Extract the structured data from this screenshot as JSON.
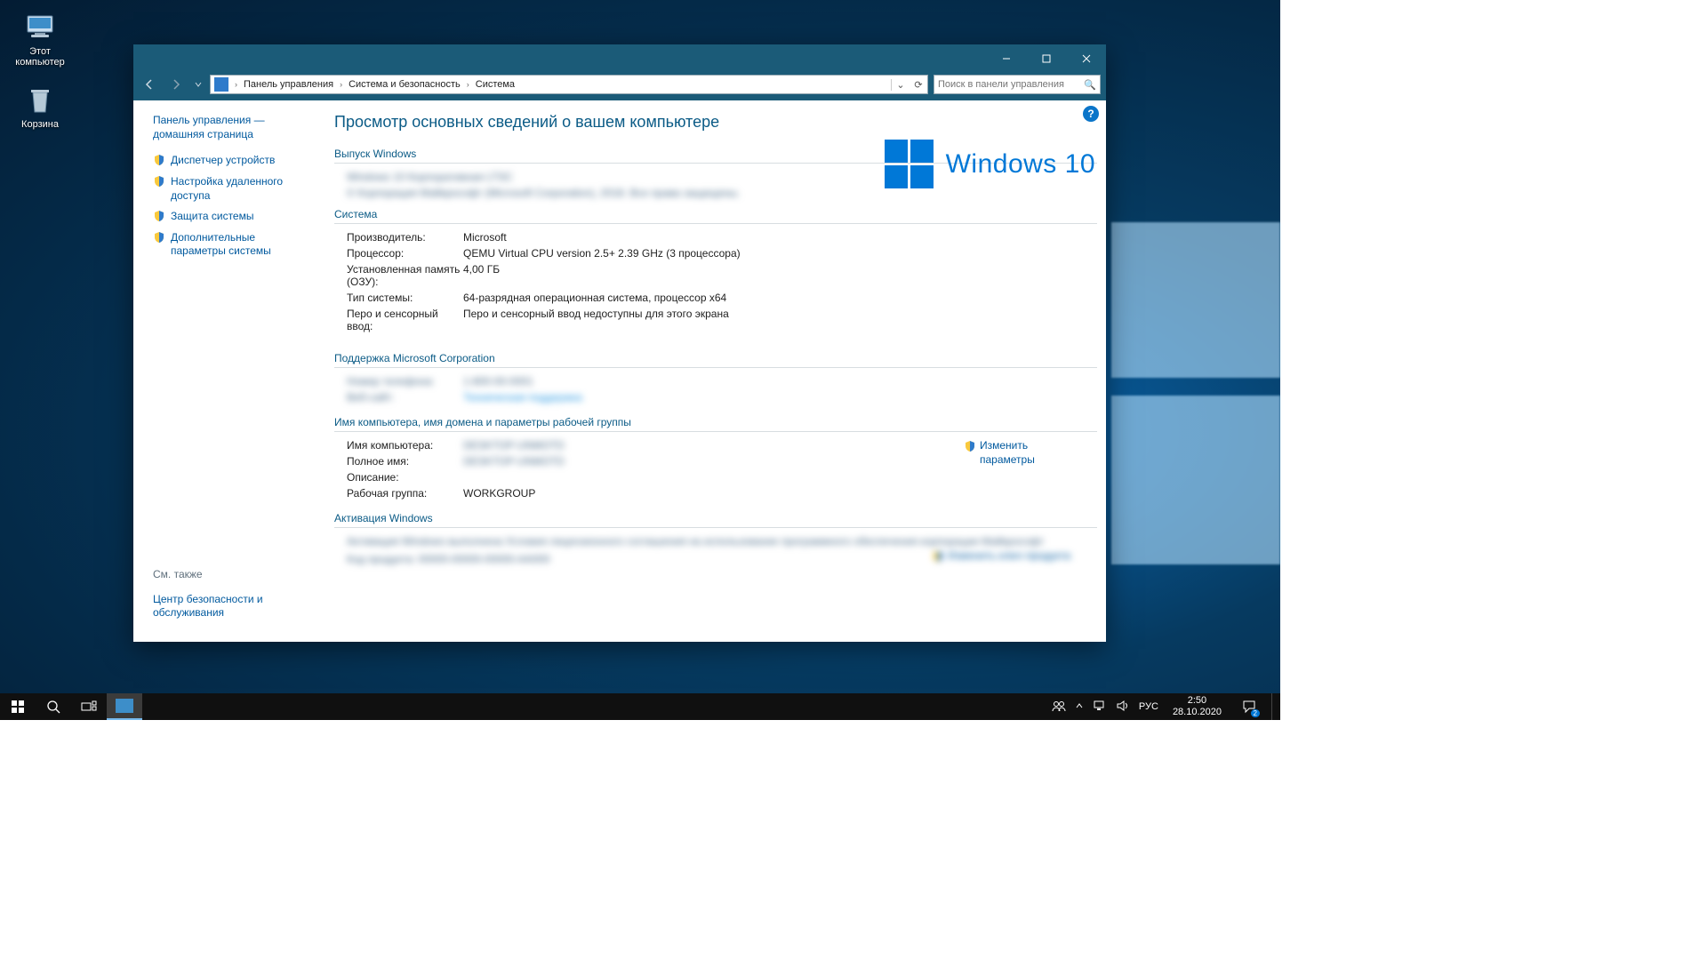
{
  "desktop": {
    "icons": {
      "pc": "Этот компьютер",
      "bin": "Корзина"
    }
  },
  "titlebar": {
    "min": "—",
    "max": "▢",
    "close": "✕"
  },
  "nav": {
    "crumbs": [
      "Панель управления",
      "Система и безопасность",
      "Система"
    ],
    "search_placeholder": "Поиск в панели управления"
  },
  "sidebar": {
    "home": "Панель управления — домашняя страница",
    "tasks": [
      "Диспетчер устройств",
      "Настройка удаленного доступа",
      "Защита системы",
      "Дополнительные параметры системы"
    ],
    "see_also_hd": "См. также",
    "see_also": [
      "Центр безопасности и обслуживания"
    ]
  },
  "main": {
    "title": "Просмотр основных сведений о вашем компьютере",
    "edition_hd": "Выпуск Windows",
    "edition_line1": "Windows 10 Корпоративная LTSC",
    "edition_line2": "© Корпорация Майкрософт (Microsoft Corporation), 2018. Все права защищены.",
    "logo_text": "Windows 10",
    "system_hd": "Система",
    "system": {
      "manufacturer_k": "Производитель:",
      "manufacturer_v": "Microsoft",
      "processor_k": "Процессор:",
      "processor_v": "QEMU Virtual CPU version 2.5+   2.39 GHz  (3 процессора)",
      "ram_k": "Установленная память (ОЗУ):",
      "ram_v": "4,00 ГБ",
      "type_k": "Тип системы:",
      "type_v": "64-разрядная операционная система, процессор x64",
      "pen_k": "Перо и сенсорный ввод:",
      "pen_v": "Перо и сенсорный ввод недоступны для этого экрана"
    },
    "support_hd": "Поддержка Microsoft Corporation",
    "support": {
      "phone_k": "Номер телефона:",
      "phone_v": "1-800-00-0001",
      "web_k": "Веб-сайт:",
      "web_v": "Техническая поддержка"
    },
    "ident_hd": "Имя компьютера, имя домена и параметры рабочей группы",
    "ident": {
      "name_k": "Имя компьютера:",
      "name_v": "DESKTOP-UNMOTD",
      "full_k": "Полное имя:",
      "full_v": "DESKTOP-UNMOTD",
      "desc_k": "Описание:",
      "desc_v": "",
      "wg_k": "Рабочая группа:",
      "wg_v": "WORKGROUP"
    },
    "change_link": "Изменить параметры",
    "activation_hd": "Активация Windows",
    "activation_line": "Активация Windows выполнена   Условия лицензионного соглашения на использование программного обеспечения корпорации Майкрософт",
    "product_id": "Код продукта: 00000-00000-00000-AA000",
    "change_key": "Изменить ключ продукта"
  },
  "taskbar": {
    "lang": "РУС",
    "time": "2:50",
    "date": "28.10.2020",
    "notif_count": "2"
  }
}
